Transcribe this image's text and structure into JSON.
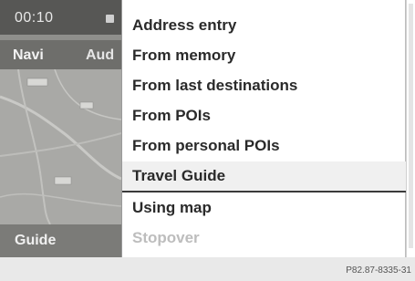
{
  "screen": {
    "clock": "00:10",
    "menubar": {
      "navi_label": "Navi",
      "audio_label": "Aud"
    },
    "bottom_label": "Guide"
  },
  "dropdown": {
    "items": [
      {
        "label": "Address entry",
        "state": "normal"
      },
      {
        "label": "From memory",
        "state": "normal"
      },
      {
        "label": "From last destinations",
        "state": "normal"
      },
      {
        "label": "From POIs",
        "state": "normal"
      },
      {
        "label": "From personal POIs",
        "state": "normal"
      },
      {
        "label": "Travel Guide",
        "state": "selected"
      },
      {
        "label": "Using map",
        "state": "normal"
      },
      {
        "label": "Stopover",
        "state": "disabled"
      }
    ]
  },
  "figure_code": "P82.87-8335-31",
  "colors": {
    "selected_row": "#f0f0f0",
    "disabled_text": "#bdbdbd",
    "screen_dark": "#575755"
  }
}
